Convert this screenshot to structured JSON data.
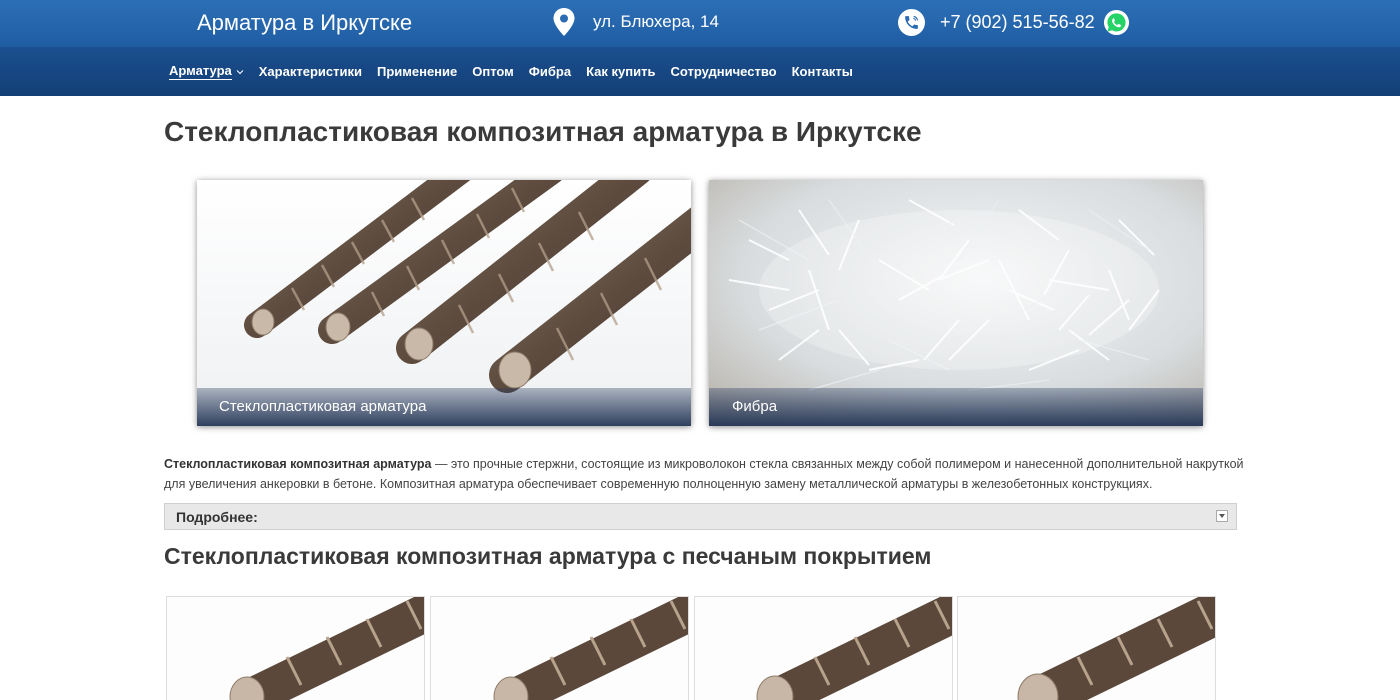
{
  "header": {
    "site_title": "Арматура в Иркутске",
    "address": "ул. Блюхера, 14",
    "phone": "+7 (902) 515-56-82",
    "icons": [
      "map-pin-icon",
      "phone-icon",
      "whatsapp-icon"
    ]
  },
  "nav": {
    "items": [
      {
        "label": "Арматура",
        "active": true,
        "has_dropdown": true
      },
      {
        "label": "Характеристики"
      },
      {
        "label": "Применение"
      },
      {
        "label": "Оптом"
      },
      {
        "label": "Фибра"
      },
      {
        "label": "Как купить"
      },
      {
        "label": "Сотрудничество"
      },
      {
        "label": "Контакты"
      }
    ]
  },
  "main": {
    "title": "Стеклопластиковая композитная арматура в Иркутске",
    "cards": [
      {
        "caption": "Стеклопластиковая арматура"
      },
      {
        "caption": "Фибра"
      }
    ],
    "intro_bold": "Стеклопластиковая композитная арматура",
    "intro_text": " — это прочные стержни, состоящие из микроволокон стекла связанных между собой полимером и нанесенной дополнительной накруткой для увеличения анкеровки в бетоне. Композитная арматура обеспечивает современную полноценную замену металлической арматуры в железобетонных конструкциях.",
    "spoiler_title": "Подробнее:",
    "section_title": "Стеклопластиковая композитная арматура с песчаным покрытием"
  },
  "colors": {
    "topbar": "#2a6bb3",
    "navbar": "#174780",
    "whatsapp": "#25d366"
  }
}
